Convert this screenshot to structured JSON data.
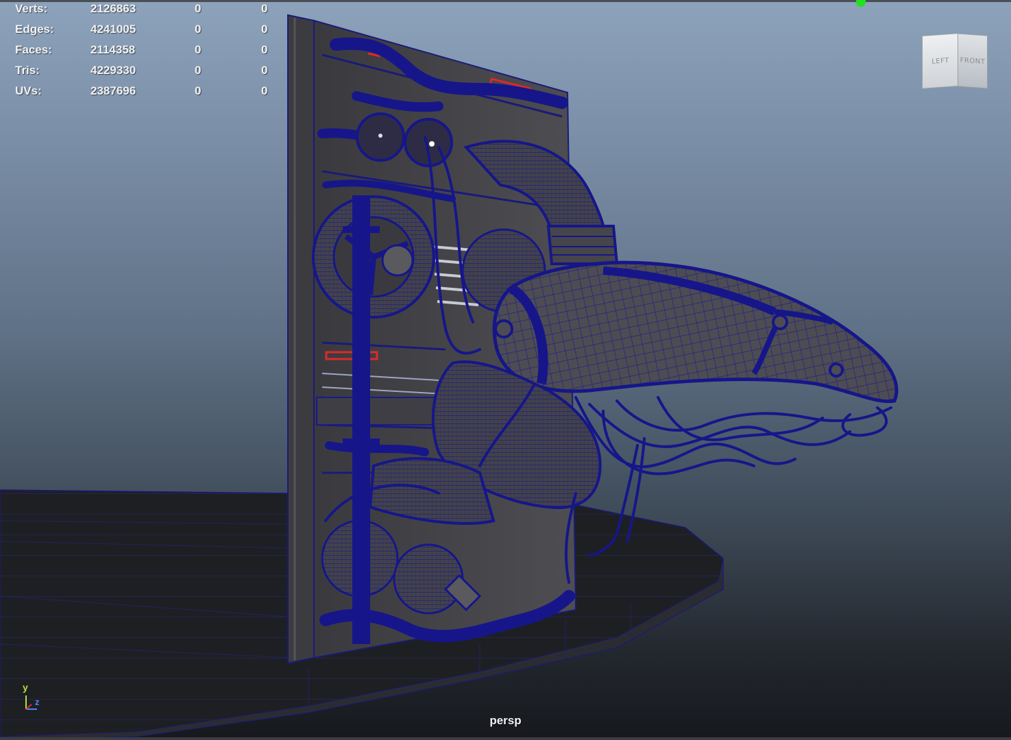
{
  "viewport": {
    "camera": "persp",
    "background_top": "#8da2bb",
    "background_bottom": "#16181c"
  },
  "heads_up_display": {
    "rows": [
      {
        "label": "Verts:",
        "value": "2126863",
        "selected": "0",
        "uv": "0"
      },
      {
        "label": "Edges:",
        "value": "4241005",
        "selected": "0",
        "uv": "0"
      },
      {
        "label": "Faces:",
        "value": "2114358",
        "selected": "0",
        "uv": "0"
      },
      {
        "label": "Tris:",
        "value": "4229330",
        "selected": "0",
        "uv": "0"
      },
      {
        "label": "UVs:",
        "value": "2387696",
        "selected": "0",
        "uv": "0"
      }
    ]
  },
  "view_cube": {
    "left_face": "LEFT",
    "front_face": "FRONT"
  },
  "axis_indicator": {
    "y_label": "y",
    "z_label": "z",
    "y_color": "#b6e03a",
    "z_color": "#4a86ff"
  },
  "colors": {
    "wireframe": "#1a1a8c",
    "mesh_fill": "#4a4a4e",
    "accent_red": "#e02828",
    "marker_green": "#22e022"
  }
}
